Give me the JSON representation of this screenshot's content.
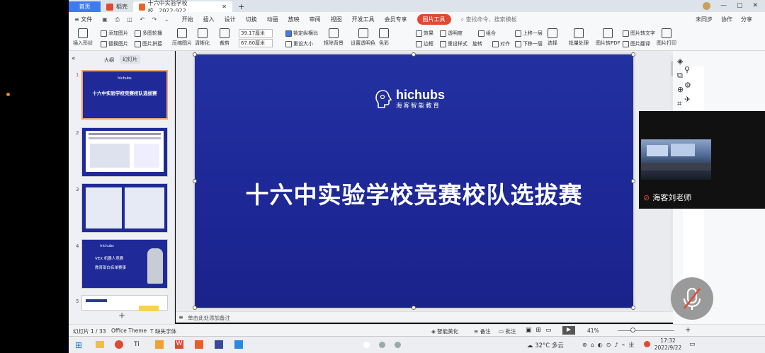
{
  "titlebar": {
    "home": "首页",
    "tab1": "稻壳",
    "tab2": "十六中实验学校校...2022-922"
  },
  "menu": {
    "file": "文件",
    "items": [
      "开始",
      "插入",
      "设计",
      "切换",
      "动画",
      "放映",
      "审阅",
      "视图",
      "开发工具",
      "会员专享"
    ],
    "pic_tools": "图片工具",
    "search": "查找命令、搜索模板",
    "sync": "未同步",
    "collab": "协作",
    "share": "分享"
  },
  "ribbon": {
    "insert_shape": "插入形状",
    "add_pic": "添加图片",
    "replace_pic": "替换图片",
    "multi_carousel": "多图轮播",
    "pic_stitch": "图片拼接",
    "compress": "压缩图片",
    "clarity": "清晰化",
    "crop": "裁剪",
    "width": "39.17厘米",
    "height": "67.80厘米",
    "lock_ratio": "锁定纵横比",
    "reset_size": "重设大小",
    "remove_bg": "抠除背景",
    "set_transparent": "设置透明色",
    "color": "色彩",
    "effect": "效果",
    "border": "边框",
    "transparency": "透明度",
    "reset_style": "重设样式",
    "combine": "组合",
    "rotate": "旋转",
    "align": "对齐",
    "up_layer": "上移一层",
    "down_layer": "下移一层",
    "select": "选择",
    "batch": "批量处理",
    "pic_to_pdf": "图片转PDF",
    "pic_to_text": "图片转文字",
    "pic_translate": "图片翻译",
    "pic_print": "图片打印"
  },
  "leftpanel": {
    "tab_outline": "大纲",
    "tab_slides": "幻灯片",
    "thumbs": [
      {
        "num": "1",
        "title": "十六中实验学校竞赛校队选拔赛"
      },
      {
        "num": "2"
      },
      {
        "num": "3"
      },
      {
        "num": "4",
        "line1": "VEX 机器人竞赛",
        "line2": "教育部白名单赛事"
      },
      {
        "num": "5"
      }
    ]
  },
  "slide": {
    "brand": "hichubs",
    "brand_sub": "海客智能教育",
    "title": "十六中实验学校竞赛校队选拔赛"
  },
  "notes": "单击此处添加备注",
  "status": {
    "slide_count": "幻灯片 1 / 33",
    "theme": "Office Theme",
    "missing_font": "缺失字体",
    "smart": "智能美化",
    "note": "备注",
    "comment": "批注",
    "zoom": "41%"
  },
  "video": {
    "name": "海客刘老师"
  },
  "taskbar": {
    "weather": "32°C 多云",
    "time": "17:32",
    "date": "2022/9/22"
  }
}
